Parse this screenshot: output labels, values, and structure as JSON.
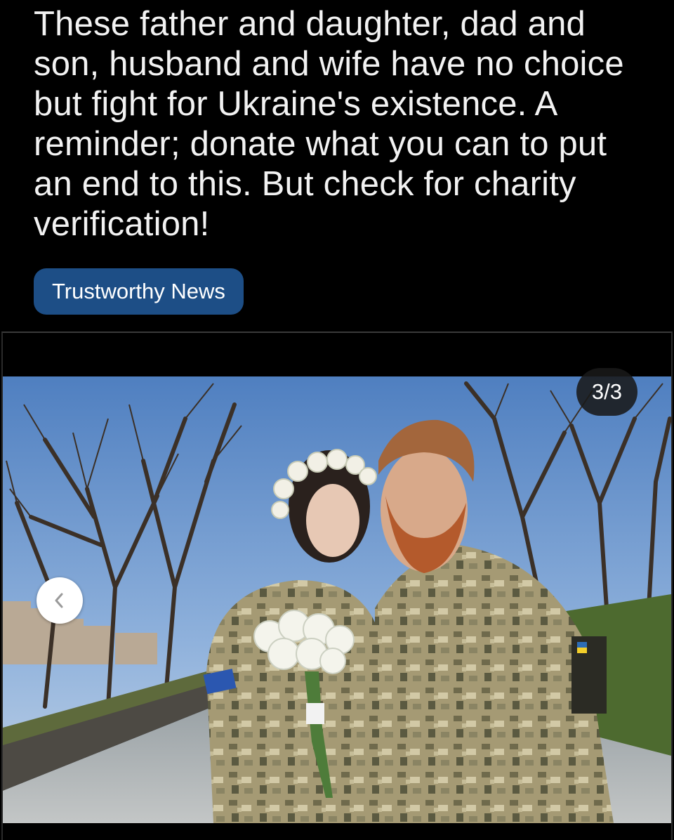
{
  "post": {
    "title": "These father and daughter, dad and son, husband and wife have no choice but fight for Ukraine's existence. A reminder; donate what you can to put an end to this. But check for charity verification!",
    "flair": "Trustworthy News"
  },
  "gallery": {
    "counter": "3/3",
    "prev_icon": "chevron-left-icon",
    "photo_subject": "couple in camouflage uniforms, woman with flower crown holding white rose bouquet, bare trees and stone walkway"
  },
  "colors": {
    "background": "#000000",
    "flair_bg": "#1d4e86",
    "text": "#f2f2f2",
    "counter_bg": "#191919"
  }
}
